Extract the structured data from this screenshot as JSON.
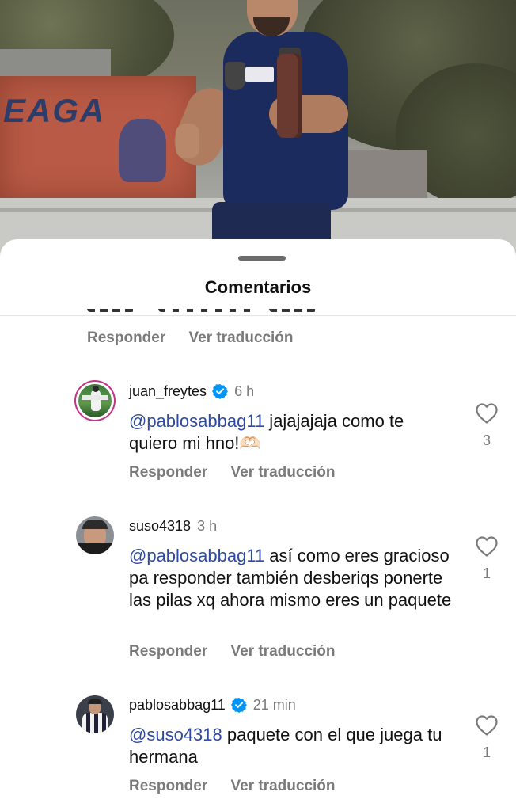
{
  "sheet": {
    "title": "Comentarios"
  },
  "actions": {
    "reply": "Responder",
    "translate": "Ver traducción"
  },
  "photo": {
    "wall_text": "EAGA"
  },
  "comments": [
    {
      "username": "juan_freytes",
      "verified": true,
      "time": "6 h",
      "mention": "@pablosabbag11",
      "text": " jajajajaja como te quiero mi hno!🫶🏻",
      "likes": "3"
    },
    {
      "username": "suso4318",
      "verified": false,
      "time": "3 h",
      "mention": "@pablosabbag11",
      "text": " así como eres gracioso pa responder también desberiqs ponerte las pilas xq ahora mismo eres un paquete",
      "likes": "1"
    },
    {
      "username": "pablosabbag11",
      "verified": true,
      "time": "21 min",
      "mention": "@suso4318",
      "text": " paquete con el que juega tu hermana",
      "likes": "1"
    }
  ],
  "colors": {
    "mention": "#2f4a9e",
    "verified": "#0095f6",
    "muted": "#7a7a7a"
  }
}
